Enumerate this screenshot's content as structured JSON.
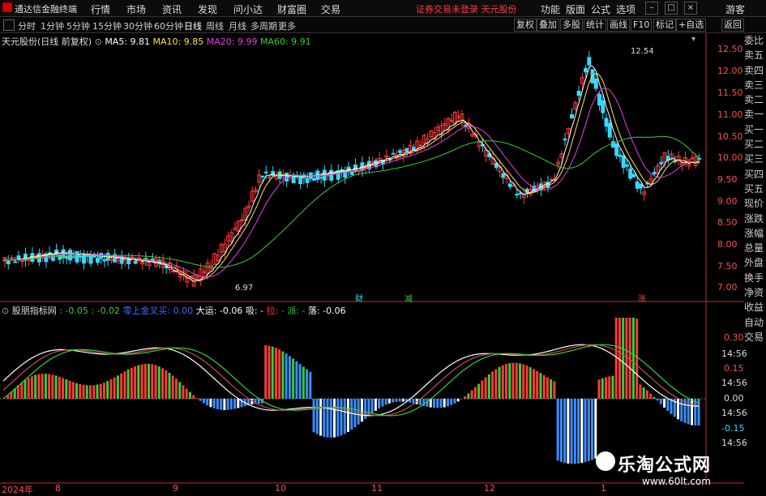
{
  "window": {
    "title": "通达信金融终端",
    "menu": [
      "行情",
      "市场",
      "资讯",
      "发现",
      "问小达",
      "财富圈",
      "交易"
    ],
    "warning": "证券交易未登录 天元股份",
    "tools": [
      "功能",
      "版面",
      "公式",
      "选项"
    ],
    "user": "游客"
  },
  "periods": [
    "分时",
    "1分钟",
    "5分钟",
    "15分钟",
    "30分钟",
    "60分钟",
    "日线",
    "周线",
    "月线",
    "多周期",
    "更多"
  ],
  "active_period": "日线",
  "right_buttons": [
    "复权",
    "叠加",
    "多股",
    "统计",
    "画线",
    "F10",
    "标记",
    "+自选",
    "返回"
  ],
  "main_legend": {
    "name": "天元股份(日线 前复权)",
    "ma5": "MA5: 9.81",
    "ma10": "MA10: 9.85",
    "ma20": "MA20: 9.99",
    "ma60": "MA60: 9.91"
  },
  "annotations": {
    "high": "12.54",
    "low": "6.97"
  },
  "price_axis": [
    "12.50",
    "12.00",
    "11.50",
    "11.00",
    "10.50",
    "10.00",
    "9.50",
    "9.00",
    "8.50",
    "8.00",
    "7.50",
    "7.00"
  ],
  "events": [
    "财",
    "减",
    "涨"
  ],
  "sub_legend": {
    "name": "股朋指标网",
    "v1": ": -0.05",
    "v2": ": -0.02",
    "v3": "零上金叉买: 0.00",
    "v4": "大运: -0.06",
    "v5": "吸: -",
    "v6": "拉: -",
    "v7": "派: -",
    "v8": "落: -0.06"
  },
  "sub_axis": [
    "0.30",
    "14:56",
    "0.15",
    "14:56",
    "0.00",
    "14:56",
    "-0.15",
    "14:56"
  ],
  "side_panel": [
    "委比",
    "卖五",
    "卖四",
    "卖三",
    "卖二",
    "卖一",
    "买一",
    "买二",
    "买三",
    "买四",
    "买五",
    "现价",
    "涨跌",
    "涨幅",
    "总量",
    "外盘",
    "换手",
    "净资",
    "收益",
    "自动",
    "交易"
  ],
  "x_axis": [
    "2024年",
    "8",
    "9",
    "10",
    "11",
    "12",
    "1"
  ],
  "watermark": {
    "title": "乐淘公式网",
    "url": "www.60lt.com"
  },
  "colors": {
    "up": "#ff3b3b",
    "down": "#3ad6ff",
    "ma5": "#ffffff",
    "ma10": "#ffe14d",
    "ma20": "#e040e0",
    "ma60": "#35d035"
  }
}
